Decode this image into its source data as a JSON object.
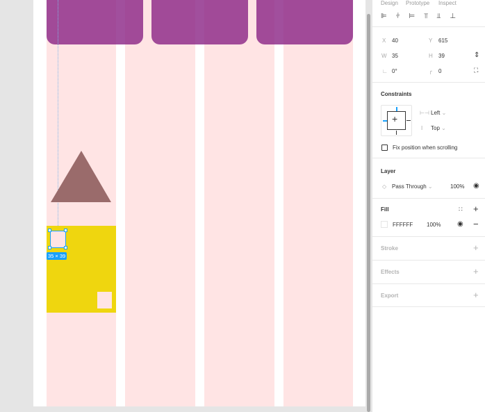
{
  "tabs": [
    "Design",
    "Prototype",
    "Inspect"
  ],
  "dimensions": {
    "x_label": "X",
    "x": "40",
    "y_label": "Y",
    "y": "615",
    "w_label": "W",
    "w": "35",
    "h_label": "H",
    "h": "39",
    "rotation": "0°",
    "radius": "0"
  },
  "constraints": {
    "title": "Constraints",
    "horizontal": "Left",
    "vertical": "Top",
    "fix_position": "Fix position when scrolling"
  },
  "layer": {
    "title": "Layer",
    "blend": "Pass Through",
    "opacity": "100%"
  },
  "fill": {
    "title": "Fill",
    "hex": "FFFFFF",
    "opacity": "100%"
  },
  "stroke": {
    "title": "Stroke"
  },
  "effects": {
    "title": "Effects"
  },
  "export": {
    "title": "Export"
  },
  "selection_size": "35 × 39",
  "colors": {
    "accent": "#18a0fb",
    "purple": "#974c93",
    "pink": "#ffe4e4",
    "yellow": "#efd60f",
    "triangle": "#9a6b6b"
  }
}
